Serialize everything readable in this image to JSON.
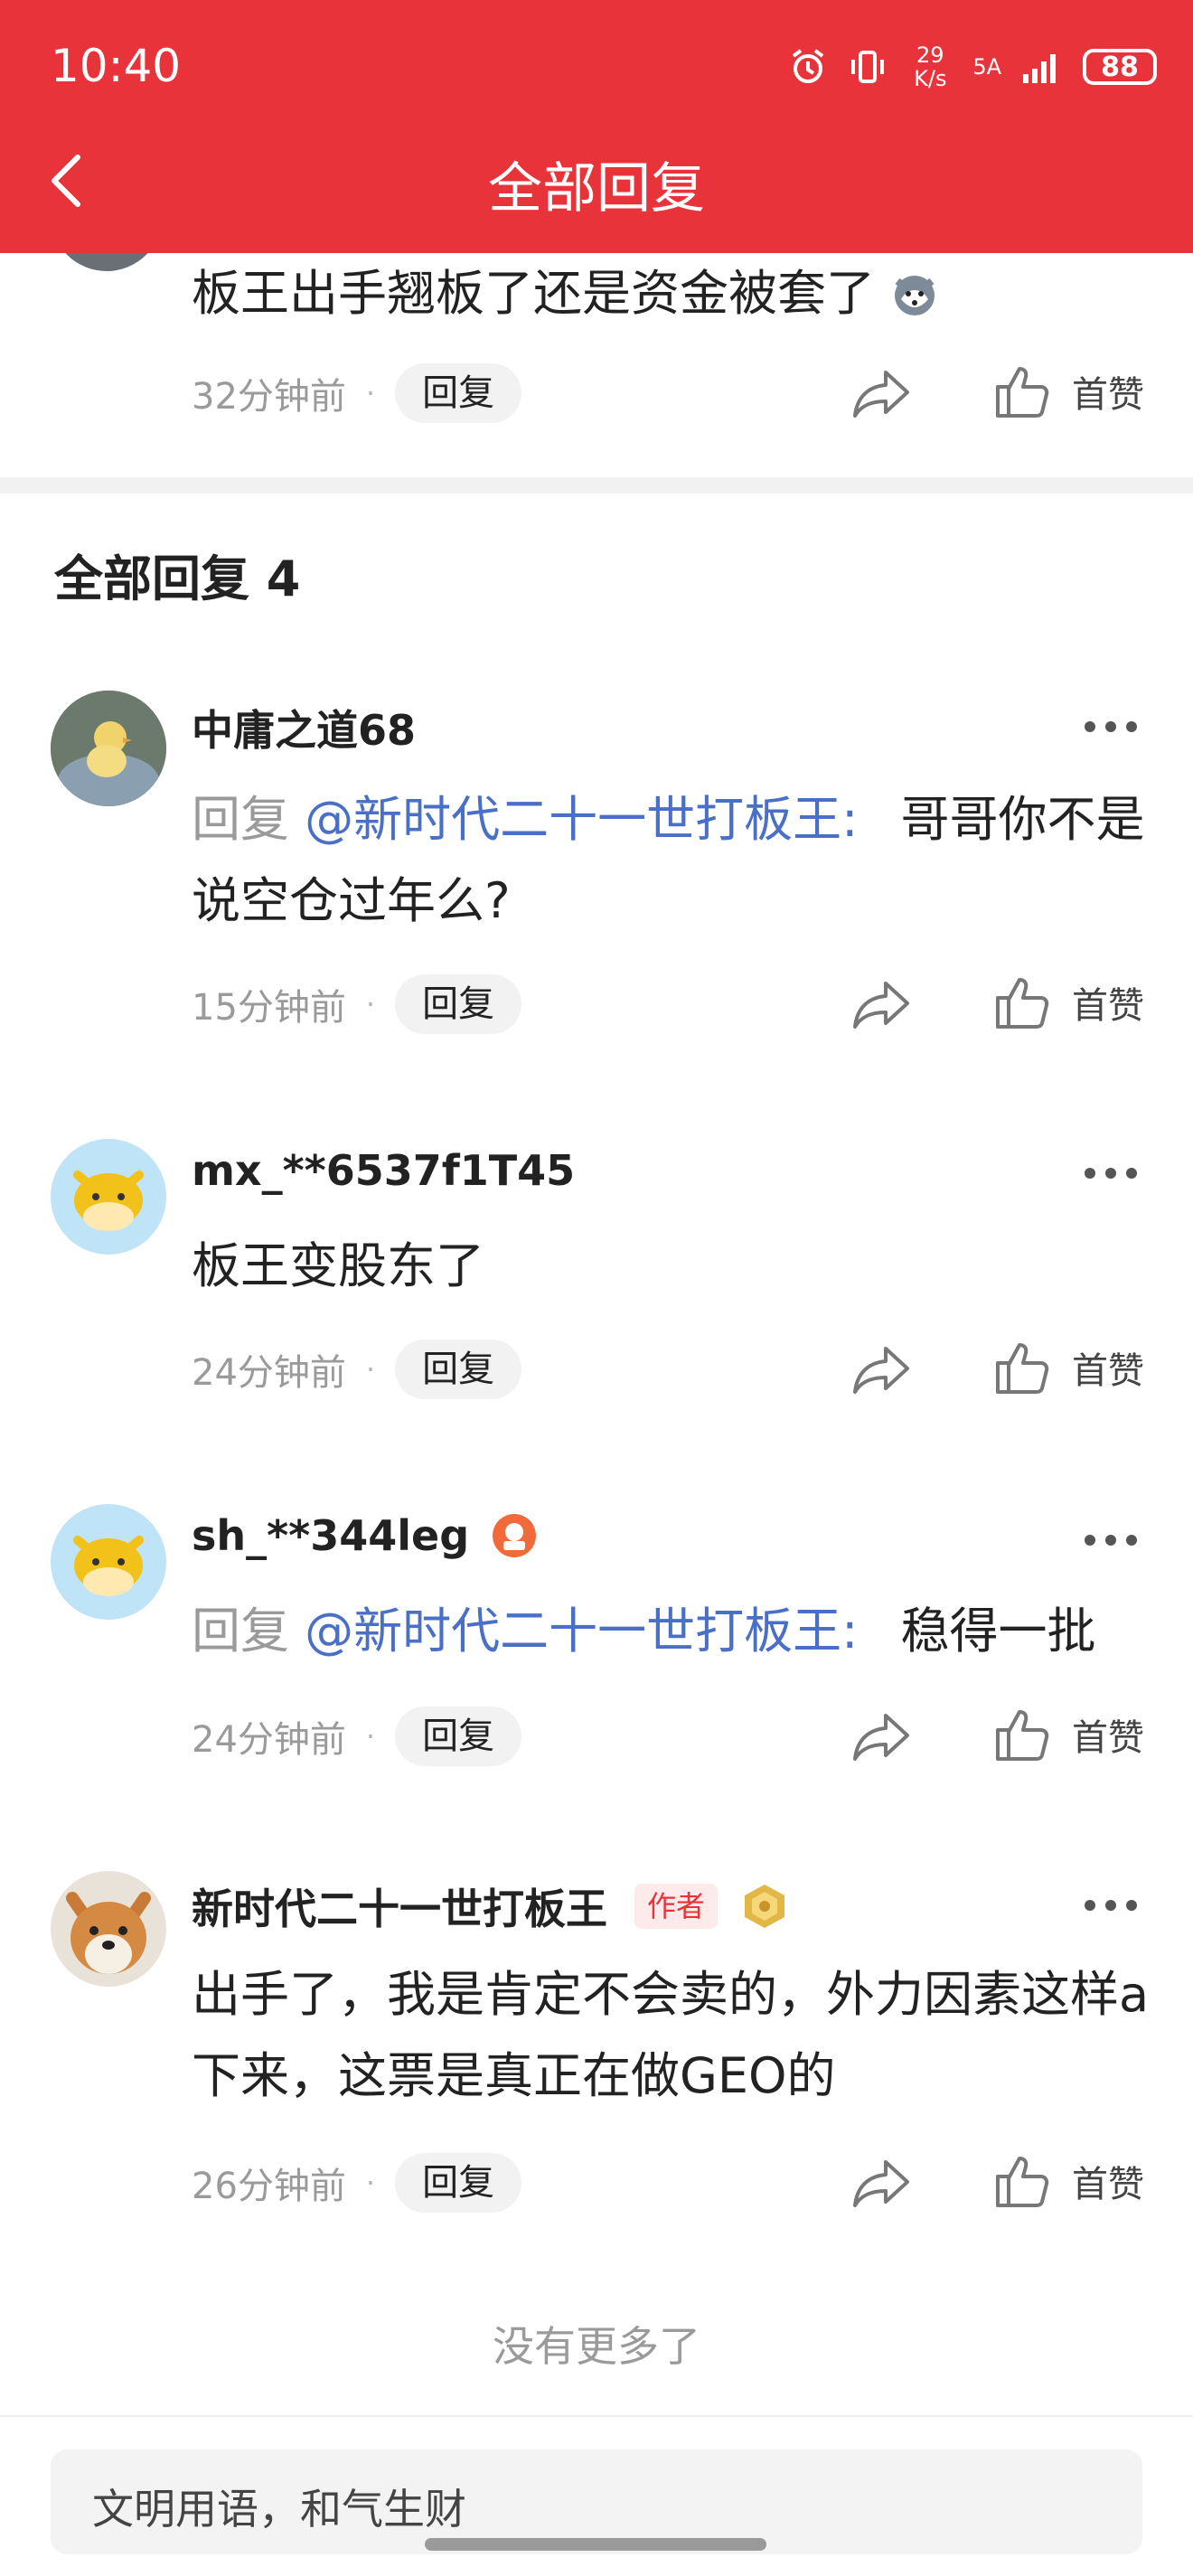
{
  "status_bar": {
    "time": "10:40",
    "network_speed": "29 K/s",
    "network_type": "5A",
    "battery": "88"
  },
  "header": {
    "title": "全部回复"
  },
  "original": {
    "text": "板王出手翘板了还是资金被套了",
    "time": "32分钟前",
    "reply_label": "回复",
    "like_label": "首赞"
  },
  "section": {
    "title": "全部回复 4"
  },
  "comments": [
    {
      "username": "中庸之道68",
      "reply_prefix": "回复",
      "mention": "@新时代二十一世打板王:",
      "text": "哥哥你不是说空仓过年么?",
      "time": "15分钟前",
      "reply_label": "回复",
      "like_label": "首赞"
    },
    {
      "username": "mx_**6537f1T45",
      "text": "板王变股东了",
      "time": "24分钟前",
      "reply_label": "回复",
      "like_label": "首赞"
    },
    {
      "username": "sh_**344leg",
      "reply_prefix": "回复",
      "mention": "@新时代二十一世打板王:",
      "text": "稳得一批",
      "time": "24分钟前",
      "reply_label": "回复",
      "like_label": "首赞"
    },
    {
      "username": "新时代二十一世打板王",
      "badge": "作者",
      "text": "出手了，我是肯定不会卖的，外力因素这样a下来，这票是真正在做GEO的",
      "time": "26分钟前",
      "reply_label": "回复",
      "like_label": "首赞"
    }
  ],
  "footer": {
    "no_more": "没有更多了",
    "input_placeholder": "文明用语，和气生财"
  },
  "colors": {
    "accent": "#e8333b",
    "mention": "#4a6fc7"
  }
}
